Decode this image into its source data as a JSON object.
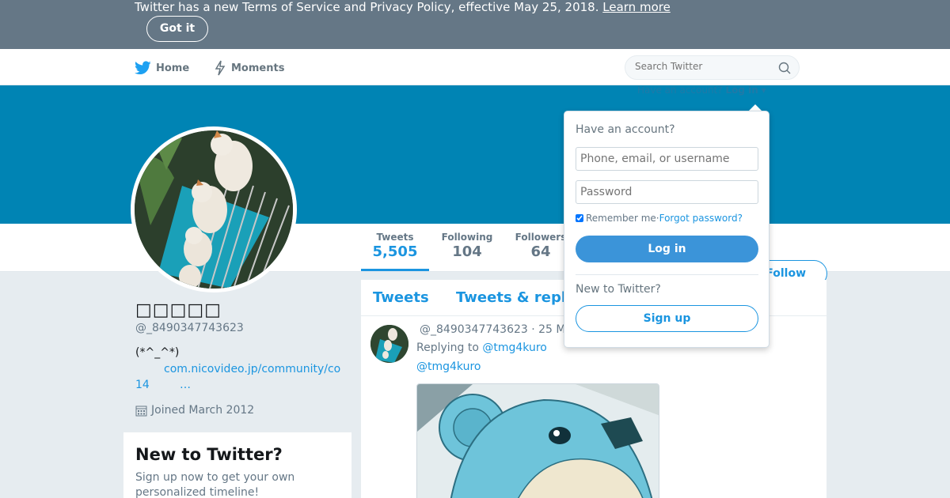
{
  "notice": {
    "text": "Twitter has a new Terms of Service and Privacy Policy, effective May 25, 2018.",
    "learn_more": "Learn more",
    "got_it": "Got it"
  },
  "nav": {
    "home": "Home",
    "moments": "Moments",
    "search_placeholder": "Search Twitter",
    "have_account": "Have an account?",
    "log_in": "Log in"
  },
  "profile": {
    "name": "□□□□□",
    "handle": "@_8490347743623",
    "bio": "(*^_^*)",
    "link_line1": "com.nicovideo.jp/community/co",
    "link_prefix": "14",
    "link_ellipsis": "…",
    "joined": "Joined March 2012",
    "follow": "Follow"
  },
  "stats": [
    {
      "label": "Tweets",
      "value": "5,505"
    },
    {
      "label": "Following",
      "value": "104"
    },
    {
      "label": "Followers",
      "value": "64"
    }
  ],
  "signup_card": {
    "title": "New to Twitter?",
    "text": "Sign up now to get your own personalized timeline!"
  },
  "timeline": {
    "tabs": [
      "Tweets",
      "Tweets & replies"
    ],
    "tweet": {
      "meta": "@_8490347743623  · 25 M",
      "replying_label": "Replying to",
      "replying_to": "@tmg4kuro",
      "mention": "@tmg4kuro"
    }
  },
  "login_dropdown": {
    "title": "Have an account?",
    "username_placeholder": "Phone, email, or username",
    "password_placeholder": "Password",
    "remember_me": "Remember me",
    "separator": " · ",
    "forgot": "Forgot password?",
    "login_button": "Log in",
    "new_to": "New to Twitter?",
    "signup_button": "Sign up"
  },
  "colors": {
    "notice_bg": "#657786",
    "banner": "#0084b4",
    "accent": "#1b95e0",
    "page_bg": "#e6ecf0"
  }
}
